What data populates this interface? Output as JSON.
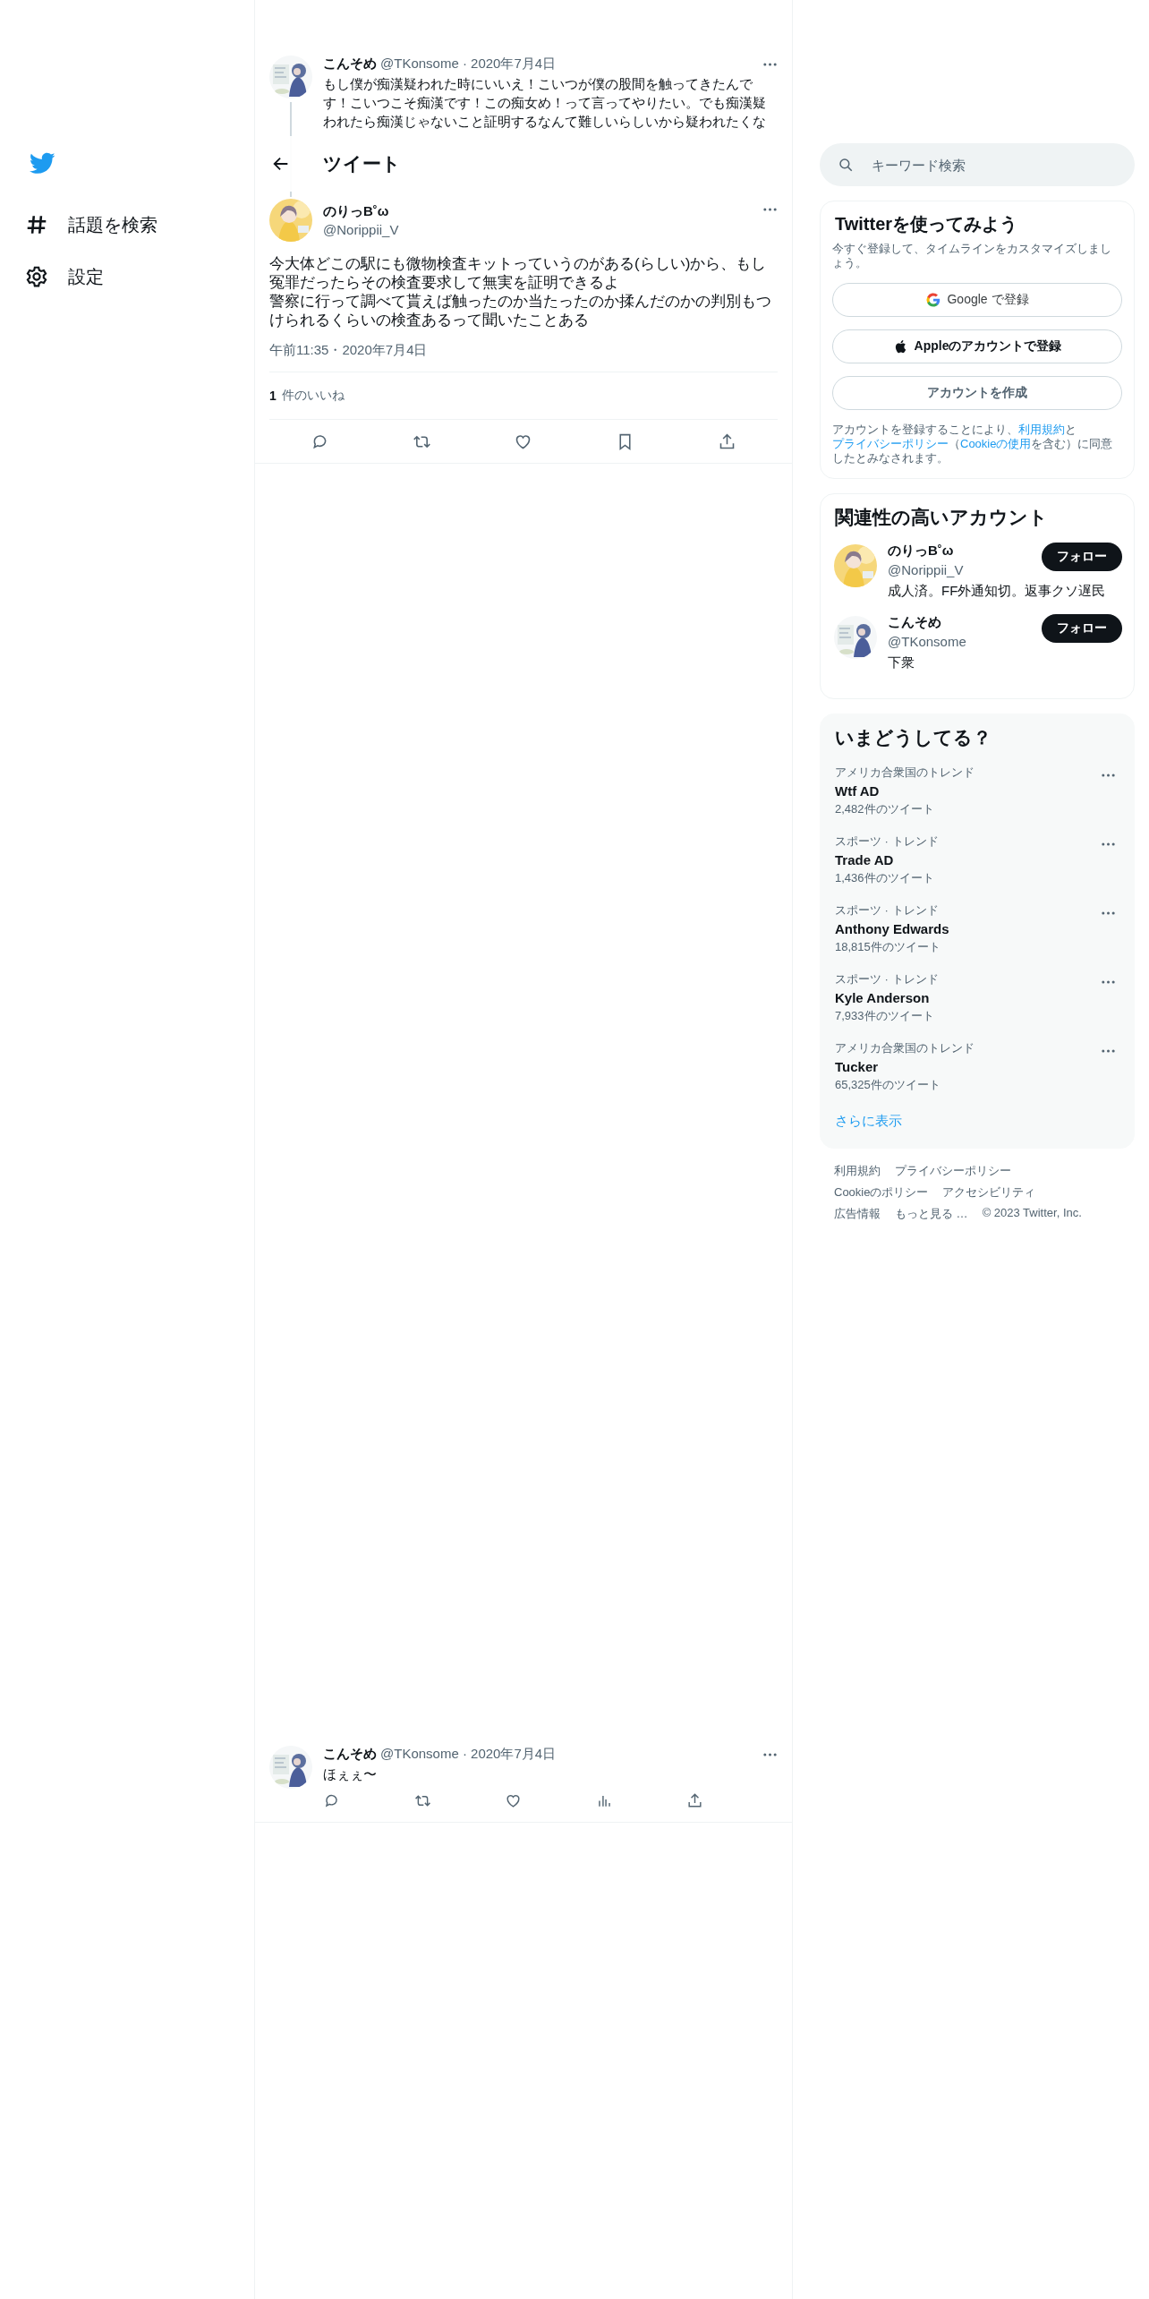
{
  "sidebar": {
    "items": [
      {
        "kind": "hash",
        "label": "話題を検索"
      },
      {
        "kind": "gear",
        "label": "設定"
      }
    ]
  },
  "header": {
    "title": "ツイート"
  },
  "thread": {
    "parent": {
      "name": "こんそめ",
      "meta": "@TKonsome · 2020年7月4日",
      "text": "もし僕が痴漢疑われた時にいいえ！こいつが僕の股間を触ってきたんです！こいつこそ痴漢です！この痴女め！って言ってやりたい。でも痴漢疑われたら痴漢じゃないこと証明するなんて難しいらしいから疑われたくな"
    },
    "main": {
      "name": "のりっB˚ω",
      "handle": "@Norippii_V",
      "lines": [
        "今大体どこの駅にも微物検査キットっていうのがある(らしい)から、もし冤罪だったらその検査要求して無実を証明できるよ",
        "警察に行って調べて貰えば触ったのか当たったのか揉んだのかの判別もつけられるくらいの検査あるって聞いたことある"
      ],
      "time": "午前11:35・2020年7月4日",
      "likes_count": "1",
      "likes_label": "件のいいね",
      "actions": [
        {
          "kind": "reply"
        },
        {
          "kind": "retweet"
        },
        {
          "kind": "like"
        },
        {
          "kind": "bookmark"
        },
        {
          "kind": "share"
        }
      ]
    },
    "reply": {
      "name": "こんそめ",
      "meta": "@TKonsome · 2020年7月4日",
      "text": "ほぇぇ〜",
      "actions": [
        {
          "kind": "reply"
        },
        {
          "kind": "retweet"
        },
        {
          "kind": "like"
        },
        {
          "kind": "views"
        },
        {
          "kind": "share"
        }
      ]
    }
  },
  "search": {
    "placeholder": "キーワード検索"
  },
  "signup": {
    "title": "Twitterを使ってみよう",
    "subtitle": "今すぐ登録して、タイムラインをカスタマイズしましょう。",
    "buttons": [
      {
        "kind": "google",
        "label": "Google で登録"
      },
      {
        "kind": "apple",
        "label": "Appleのアカウントで登録"
      },
      {
        "kind": "plain",
        "label": "アカウントを作成"
      }
    ],
    "legal": [
      {
        "text": "アカウントを登録することにより、",
        "link": false
      },
      {
        "text": "利用規約",
        "link": true
      },
      {
        "text": "と",
        "link": false
      },
      {
        "text": "プライバシーポリシー",
        "link": true
      },
      {
        "text": "（",
        "link": false
      },
      {
        "text": "Cookieの使用",
        "link": true
      },
      {
        "text": "を含む）に同意したとみなされます。",
        "link": false
      }
    ]
  },
  "relevant": {
    "title": "関連性の高いアカウント",
    "accounts": [
      {
        "name": "のりっB˚ω",
        "handle": "@Norippii_V",
        "bio": "成人済。FF外通知切。返事クソ遅民",
        "button": "フォロー"
      },
      {
        "name": "こんそめ",
        "handle": "@TKonsome",
        "bio": "下衆",
        "button": "フォロー"
      }
    ]
  },
  "trends": {
    "title": "いまどうしてる？",
    "items": [
      {
        "context": "アメリカ合衆国のトレンド",
        "name": "Wtf AD",
        "count": "2,482件のツイート"
      },
      {
        "context": "スポーツ · トレンド",
        "name": "Trade AD",
        "count": "1,436件のツイート"
      },
      {
        "context": "スポーツ · トレンド",
        "name": "Anthony Edwards",
        "count": "18,815件のツイート"
      },
      {
        "context": "スポーツ · トレンド",
        "name": "Kyle Anderson",
        "count": "7,933件のツイート"
      },
      {
        "context": "アメリカ合衆国のトレンド",
        "name": "Tucker",
        "count": "65,325件のツイート"
      }
    ],
    "more": "さらに表示"
  },
  "footer": {
    "links": [
      "利用規約",
      "プライバシーポリシー",
      "Cookieのポリシー",
      "アクセシビリティ",
      "広告情報",
      "もっと見る …"
    ],
    "copyright": "© 2023 Twitter, Inc."
  }
}
